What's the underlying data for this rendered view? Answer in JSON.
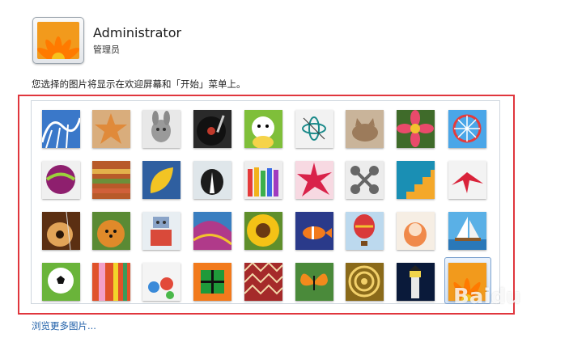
{
  "user": {
    "name": "Administrator",
    "role": "管理员"
  },
  "hint": "您选择的图片将显示在欢迎屏幕和「开始」菜单上。",
  "gallery": {
    "pictures": [
      [
        "roller-coaster-picture",
        "starfish-picture",
        "robot-rabbit-picture",
        "record-player-picture",
        "lucky-cat-picture",
        "gyroscope-picture",
        "kitten-picture",
        "pink-flower-picture",
        "ferris-wheel-picture"
      ],
      [
        "ball-picture",
        "yarn-picture",
        "yellow-leaf-picture",
        "dog-picture",
        "crayons-picture",
        "red-star-picture",
        "jacks-picture",
        "stairs-picture",
        "paper-crane-picture"
      ],
      [
        "guitar-picture",
        "pomeranian-picture",
        "toy-robot-picture",
        "scarf-picture",
        "sunflower-picture",
        "clownfish-picture",
        "hot-air-balloon-picture",
        "doll-picture",
        "sailboat-picture"
      ],
      [
        "soccer-ball-picture",
        "fabric-picture",
        "marbles-picture",
        "green-window-picture",
        "pattern-picture",
        "butterfly-picture",
        "spiral-picture",
        "lighthouse-picture",
        "orange-flower-picture"
      ]
    ],
    "selected": "orange-flower-picture"
  },
  "more_link": "浏览更多图片...",
  "watermark": "Baidu"
}
